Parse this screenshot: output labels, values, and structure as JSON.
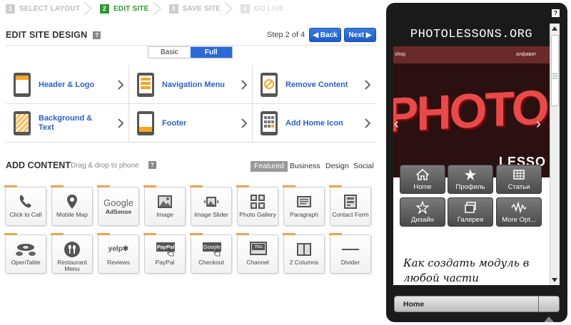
{
  "steps": [
    {
      "num": "1",
      "label": "SELECT LAYOUT",
      "state": "done"
    },
    {
      "num": "2",
      "label": "EDIT SITE",
      "state": "active"
    },
    {
      "num": "3",
      "label": "SAVE SITE",
      "state": "todo"
    },
    {
      "num": "4",
      "label": "GO LIVE",
      "state": "todo"
    }
  ],
  "header": {
    "title": "EDIT SITE DESIGN",
    "help": "?",
    "step_of": "Step 2 of 4",
    "back_label": "◀ Back",
    "next_label": "Next ▶"
  },
  "mode_toggle": {
    "basic": "Basic",
    "full": "Full",
    "selected": "Full"
  },
  "edit_options": [
    {
      "label": "Header & Logo",
      "icon": "phone-header-icon"
    },
    {
      "label": "Navigation Menu",
      "icon": "phone-menu-icon"
    },
    {
      "label": "Remove Content",
      "icon": "phone-remove-icon"
    },
    {
      "label": "Background & Text",
      "icon": "phone-background-icon"
    },
    {
      "label": "Footer",
      "icon": "phone-footer-icon"
    },
    {
      "label": "Add Home Icon",
      "icon": "phone-grid-icon"
    }
  ],
  "add_content": {
    "title": "ADD CONTENT",
    "hint": "Drag & drop to phone",
    "help": "?",
    "categories": [
      "Featured",
      "Business",
      "Design",
      "Social"
    ],
    "selected_category": "Featured",
    "tiles": [
      {
        "label": "Click to Call",
        "icon": "phone-handset-icon"
      },
      {
        "label": "Mobile Map",
        "icon": "map-pin-icon"
      },
      {
        "label": "",
        "icon": "google-adsense-icon",
        "logo_text": "Google",
        "logo_sub": "AdSense"
      },
      {
        "label": "Image",
        "icon": "image-icon"
      },
      {
        "label": "Image Slider",
        "icon": "image-slider-icon"
      },
      {
        "label": "Photo Gallery",
        "icon": "photo-gallery-icon"
      },
      {
        "label": "Paragraph",
        "icon": "paragraph-icon"
      },
      {
        "label": "Contact Form",
        "icon": "contact-form-icon"
      },
      {
        "label": "OpenTable",
        "icon": "opentable-icon"
      },
      {
        "label": "Restaurant Menu",
        "icon": "restaurant-menu-icon"
      },
      {
        "label": "Reviews",
        "icon": "yelp-icon",
        "logo_text": "yelp✱"
      },
      {
        "label": "PayPal",
        "icon": "paypal-icon",
        "logo_text": "PayPal"
      },
      {
        "label": "Checkout",
        "icon": "google-checkout-icon",
        "logo_text": "Google"
      },
      {
        "label": "Channel",
        "icon": "youtube-channel-icon",
        "logo_text": "You"
      },
      {
        "label": "2 Columns",
        "icon": "two-columns-icon"
      },
      {
        "label": "Divider",
        "icon": "divider-icon"
      }
    ]
  },
  "phone": {
    "help": "?",
    "site_title": "PHOTOLESSONS.ORG",
    "banner": {
      "left_text": "shop",
      "right_text": "алфавит",
      "big_text": "PHOTO",
      "sub_text": "LESSO",
      "prev": "‹",
      "next": "›"
    },
    "menu": [
      {
        "label": "Home",
        "icon": "home-icon"
      },
      {
        "label": "Профиль",
        "icon": "star-icon"
      },
      {
        "label": "Статьи",
        "icon": "table-icon"
      },
      {
        "label": "Дизайн",
        "icon": "star-outline-icon"
      },
      {
        "label": "Галерея",
        "icon": "gallery-icon"
      },
      {
        "label": "More Opt...",
        "icon": "more-icon"
      }
    ],
    "article_text": "Как создать модуль в любой части",
    "bottom_label": "Home"
  },
  "colors": {
    "accent_blue": "#2a6ad8",
    "active_green": "#2a9a2a",
    "tile_tab": "#f0a050",
    "link_blue": "#2a5fc8"
  }
}
